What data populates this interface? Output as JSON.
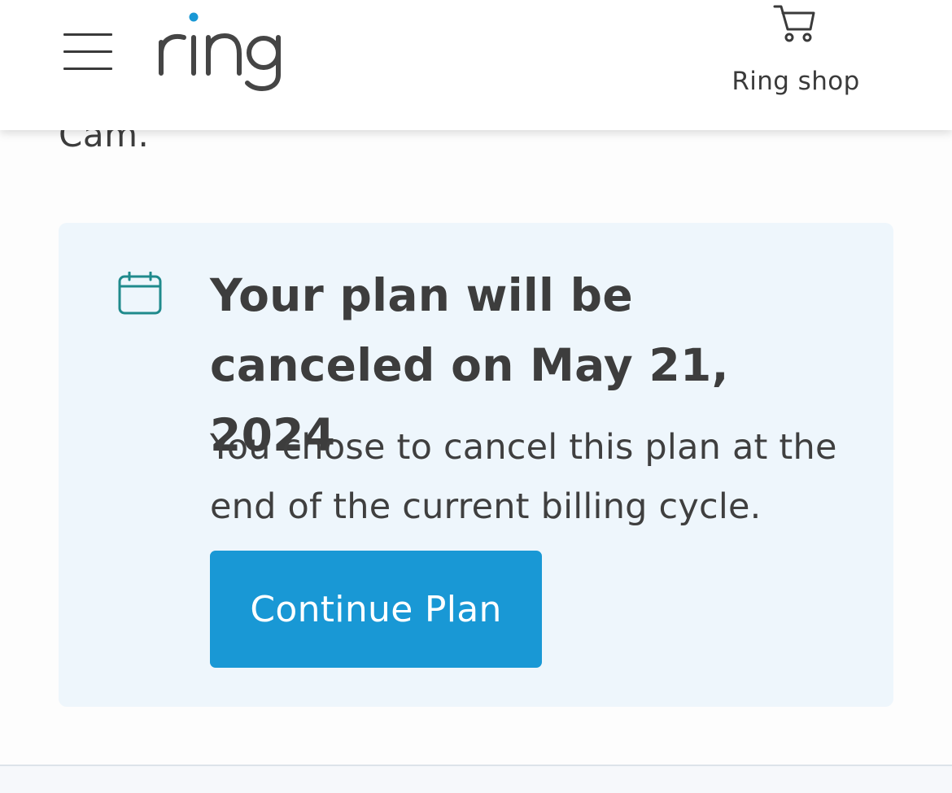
{
  "header": {
    "logo_text": "ring",
    "shop_label": "Ring shop",
    "icons": {
      "menu": "hamburger-menu-icon",
      "cart": "shopping-cart-icon"
    }
  },
  "scrolled_text": "Cam.",
  "notice": {
    "icon": "calendar-icon",
    "title": "Your plan will be canceled on May 21, 2024",
    "body": "You chose to cancel this plan at the end of the current billing cycle.",
    "button_label": "Continue Plan"
  },
  "colors": {
    "brand_blue": "#1998d5",
    "logo_dot": "#1998d5",
    "card_background": "#eef6fc",
    "icon_teal": "#1f8a8c",
    "text_dark": "#3d3d3d"
  }
}
